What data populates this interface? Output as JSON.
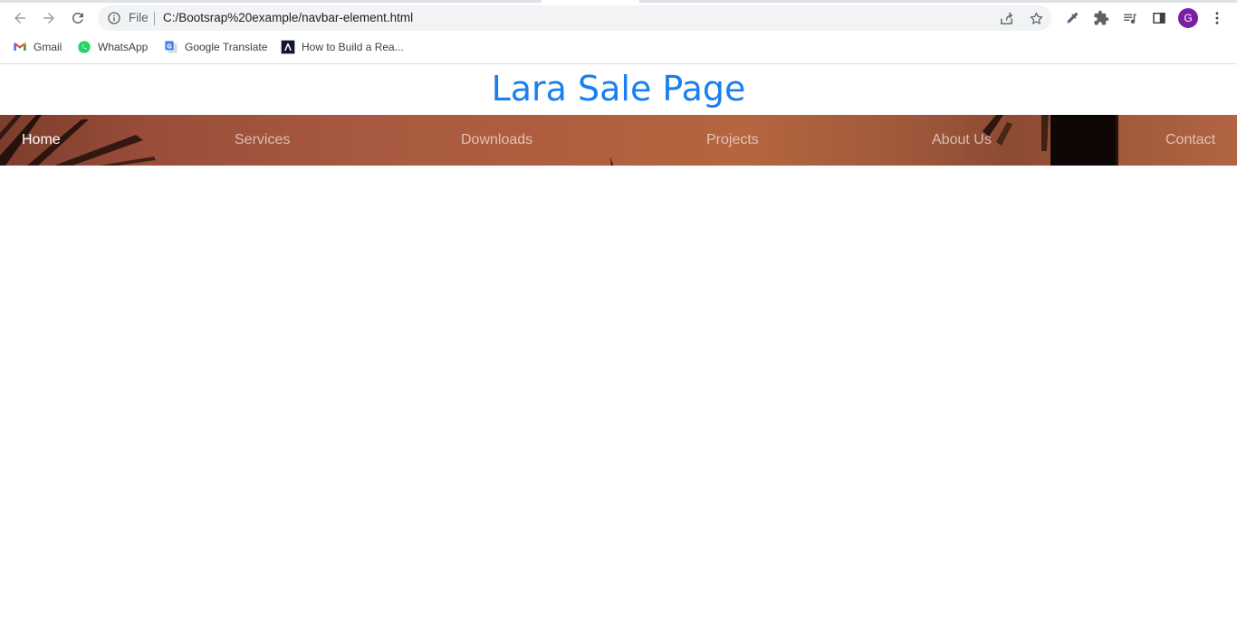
{
  "browser": {
    "address_scheme": "File",
    "address_url": "C:/Bootsrap%20example/navbar-element.html",
    "profile_initial": "G",
    "icons": {
      "back": "arrow-left-icon",
      "forward": "arrow-right-icon",
      "reload": "reload-icon",
      "site_info": "info-icon",
      "share": "share-icon",
      "bookmark": "star-icon",
      "eyedropper": "eyedropper-icon",
      "extensions": "puzzle-icon",
      "media": "media-queue-icon",
      "side_panel": "side-panel-icon",
      "menu": "kebab-menu-icon"
    }
  },
  "bookmarks": [
    {
      "label": "Gmail",
      "icon": "gmail-icon"
    },
    {
      "label": "WhatsApp",
      "icon": "whatsapp-icon"
    },
    {
      "label": "Google Translate",
      "icon": "google-translate-icon"
    },
    {
      "label": "How to Build a Rea...",
      "icon": "site-favicon-icon"
    }
  ],
  "page": {
    "title": "Lara Sale Page",
    "title_color": "#1a7ff0",
    "nav": [
      {
        "label": "Home",
        "active": true
      },
      {
        "label": "Services",
        "active": false
      },
      {
        "label": "Downloads",
        "active": false
      },
      {
        "label": "Projects",
        "active": false
      },
      {
        "label": "About Us",
        "active": false
      },
      {
        "label": "Contact",
        "active": false
      }
    ]
  }
}
